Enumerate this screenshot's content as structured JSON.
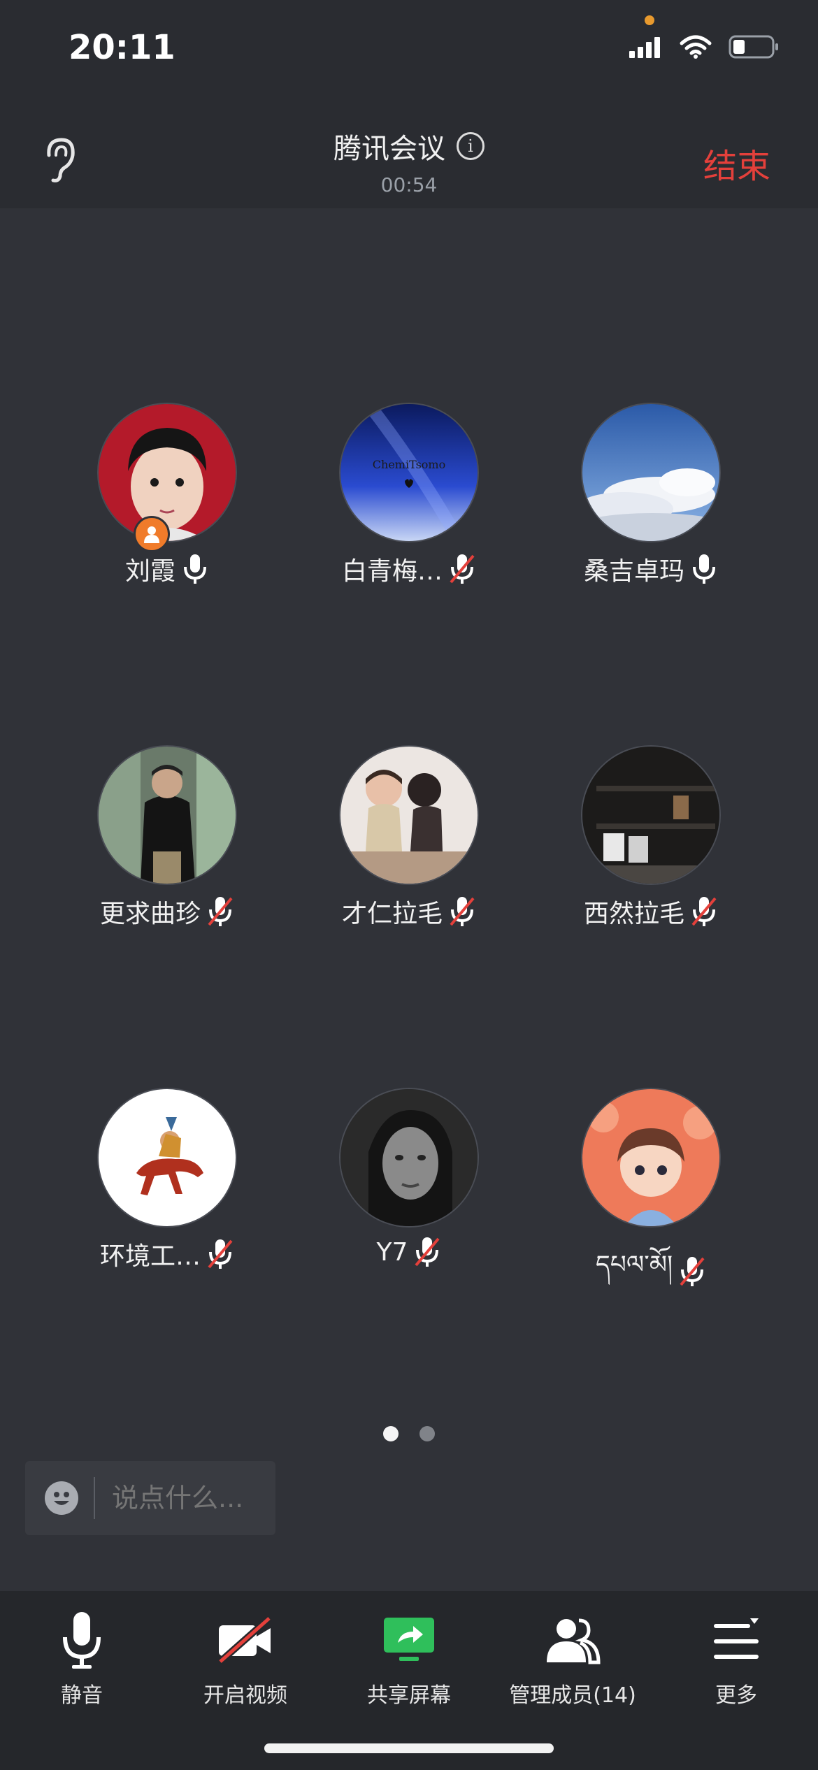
{
  "status_bar": {
    "time": "20:11"
  },
  "header": {
    "title": "腾讯会议",
    "timer": "00:54",
    "end_label": "结束"
  },
  "participants": [
    {
      "name": "刘霞",
      "mic": "on",
      "host": true,
      "avatar": "boy-portrait"
    },
    {
      "name": "白青梅…",
      "mic": "muted",
      "host": false,
      "avatar": "galaxy-sky",
      "avatar_text": "ChemiTsomo"
    },
    {
      "name": "桑吉卓玛",
      "mic": "on",
      "host": false,
      "avatar": "cloud-sky"
    },
    {
      "name": "更求曲珍",
      "mic": "muted",
      "host": false,
      "avatar": "street-photo"
    },
    {
      "name": "才仁拉毛",
      "mic": "muted",
      "host": false,
      "avatar": "kids-photo"
    },
    {
      "name": "西然拉毛",
      "mic": "muted",
      "host": false,
      "avatar": "room-photo"
    },
    {
      "name": "环境工…",
      "mic": "muted",
      "host": false,
      "avatar": "rider-painting"
    },
    {
      "name": "Y7",
      "mic": "muted",
      "host": false,
      "avatar": "bw-portrait"
    },
    {
      "name": "དཔལ་མོ།",
      "mic": "muted",
      "host": false,
      "avatar": "cartoon-girl"
    }
  ],
  "pagination": {
    "pages": 2,
    "current": 1
  },
  "chat": {
    "placeholder": "说点什么..."
  },
  "toolbar": {
    "mute": "静音",
    "video": "开启视频",
    "share": "共享屏幕",
    "members": "管理成员(14)",
    "more": "更多"
  },
  "colors": {
    "end": "#e4403b",
    "host_badge": "#f07b2a",
    "share_green": "#2fbf5b",
    "muted_slash": "#e4403b"
  }
}
